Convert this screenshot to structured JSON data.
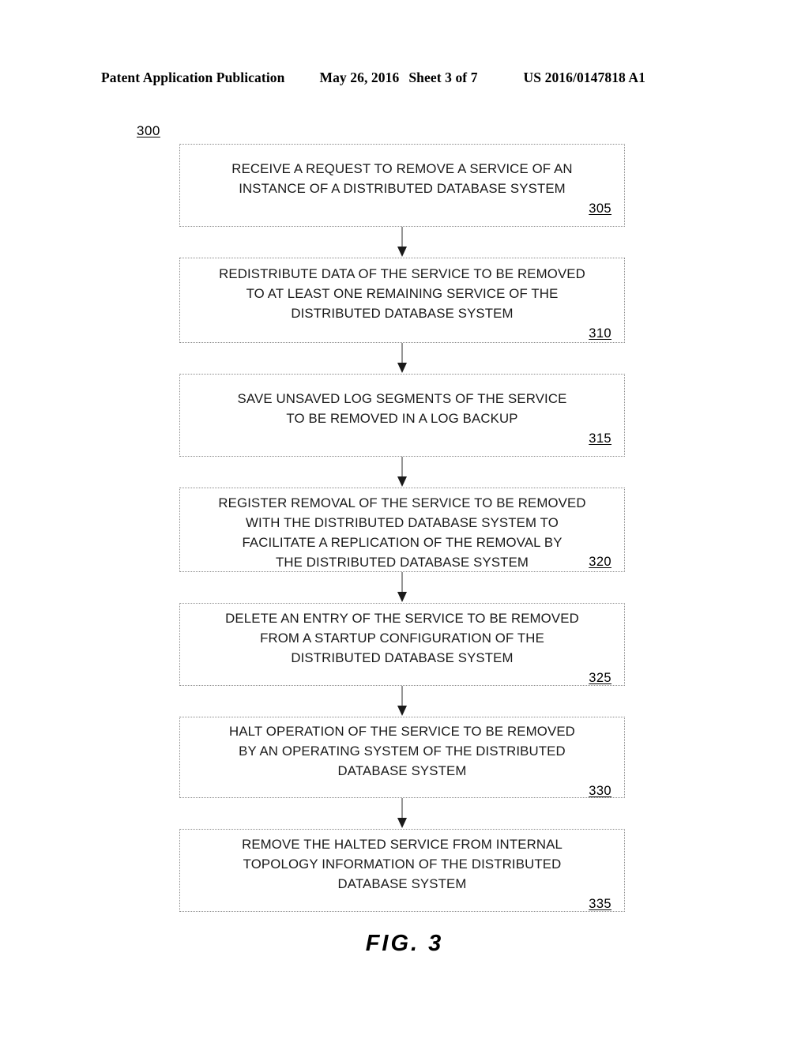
{
  "header": {
    "publication": "Patent Application Publication",
    "date": "May 26, 2016",
    "sheet": "Sheet 3 of 7",
    "patent_number": "US 2016/0147818 A1"
  },
  "figure": {
    "diagram_ref": "300",
    "caption": "FIG.  3"
  },
  "flowchart": {
    "steps": [
      {
        "ref": "305",
        "text": "RECEIVE A REQUEST TO REMOVE A SERVICE OF AN\nINSTANCE OF A DISTRIBUTED DATABASE SYSTEM"
      },
      {
        "ref": "310",
        "text": "REDISTRIBUTE DATA OF THE SERVICE TO BE REMOVED\nTO AT LEAST ONE REMAINING SERVICE OF THE\nDISTRIBUTED DATABASE SYSTEM"
      },
      {
        "ref": "315",
        "text": "SAVE UNSAVED LOG SEGMENTS OF THE SERVICE\nTO BE REMOVED IN A LOG BACKUP"
      },
      {
        "ref": "320",
        "text": "REGISTER REMOVAL OF THE SERVICE TO BE REMOVED\nWITH THE DISTRIBUTED DATABASE SYSTEM TO\nFACILITATE A REPLICATION OF THE REMOVAL BY\nTHE DISTRIBUTED DATABASE SYSTEM"
      },
      {
        "ref": "325",
        "text": "DELETE AN ENTRY OF THE SERVICE TO BE REMOVED\nFROM A STARTUP CONFIGURATION OF THE\nDISTRIBUTED DATABASE SYSTEM"
      },
      {
        "ref": "330",
        "text": "HALT OPERATION OF THE SERVICE TO BE REMOVED\nBY AN OPERATING SYSTEM OF THE DISTRIBUTED\nDATABASE SYSTEM"
      },
      {
        "ref": "335",
        "text": "REMOVE THE HALTED SERVICE FROM INTERNAL\nTOPOLOGY INFORMATION OF THE DISTRIBUTED\nDATABASE SYSTEM"
      }
    ]
  }
}
